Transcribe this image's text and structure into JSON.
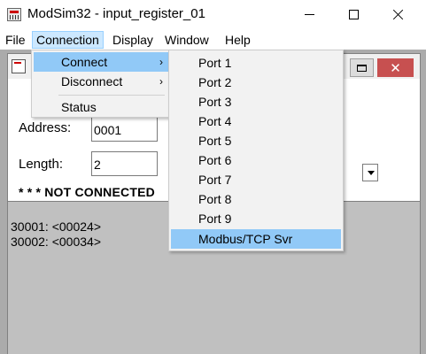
{
  "window": {
    "title": "ModSim32 - input_register_01"
  },
  "menubar": {
    "items": [
      {
        "label": "File"
      },
      {
        "label": "Connection"
      },
      {
        "label": "Display"
      },
      {
        "label": "Window"
      },
      {
        "label": "Help"
      }
    ]
  },
  "connection_menu": {
    "items": [
      {
        "label": "Connect",
        "arrow": "›"
      },
      {
        "label": "Disconnect",
        "arrow": "›"
      },
      {
        "label": "Status",
        "arrow": ""
      }
    ]
  },
  "connect_submenu": {
    "items": [
      {
        "label": "Port 1"
      },
      {
        "label": "Port 2"
      },
      {
        "label": "Port 3"
      },
      {
        "label": "Port 4"
      },
      {
        "label": "Port 5"
      },
      {
        "label": "Port 6"
      },
      {
        "label": "Port 7"
      },
      {
        "label": "Port 8"
      },
      {
        "label": "Port 9"
      },
      {
        "label": "Modbus/TCP Svr"
      }
    ]
  },
  "child_window": {
    "close_glyph": "✕"
  },
  "form": {
    "address_label": "Address:",
    "address_value": "0001",
    "length_label": "Length:",
    "length_value": "2",
    "status": "* * * NOT CONNECTED"
  },
  "registers": [
    {
      "text": "30001: <00024>"
    },
    {
      "text": "30002: <00034>"
    }
  ],
  "colors": {
    "menu_highlight": "#91c9f7",
    "menubar_active": "#cce8ff",
    "child_close": "#c75050",
    "mdi_background": "#ababab"
  }
}
